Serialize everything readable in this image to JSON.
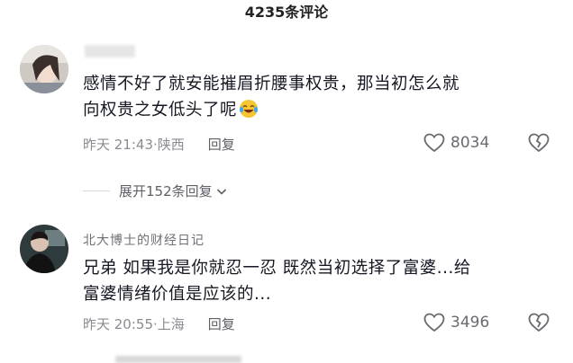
{
  "header": {
    "title": "4235条评论"
  },
  "comments": [
    {
      "username": "",
      "text_line1": "感情不好了就安能摧眉折腰事权贵，那当初怎么就",
      "text_line2": "向权贵之女低头了呢",
      "time": "昨天 21:43",
      "separator": " · ",
      "location": "陕西",
      "reply_label": "回复",
      "likes": "8034"
    },
    {
      "username": "北大博士的财经日记",
      "text_line1": "兄弟 如果我是你就忍一忍 既然当初选择了富婆...给",
      "text_line2": "富婆情绪价值是应该的...",
      "time": "昨天 20:55",
      "separator": " · ",
      "location": "上海",
      "reply_label": "回复",
      "likes": "3496"
    }
  ],
  "expand_replies": "展开152条回复",
  "icons": {
    "like": "heart-outline-icon",
    "dislike": "broken-heart-icon",
    "emoji": "laughing-crying-emoji",
    "chevron": "chevron-down-icon"
  }
}
